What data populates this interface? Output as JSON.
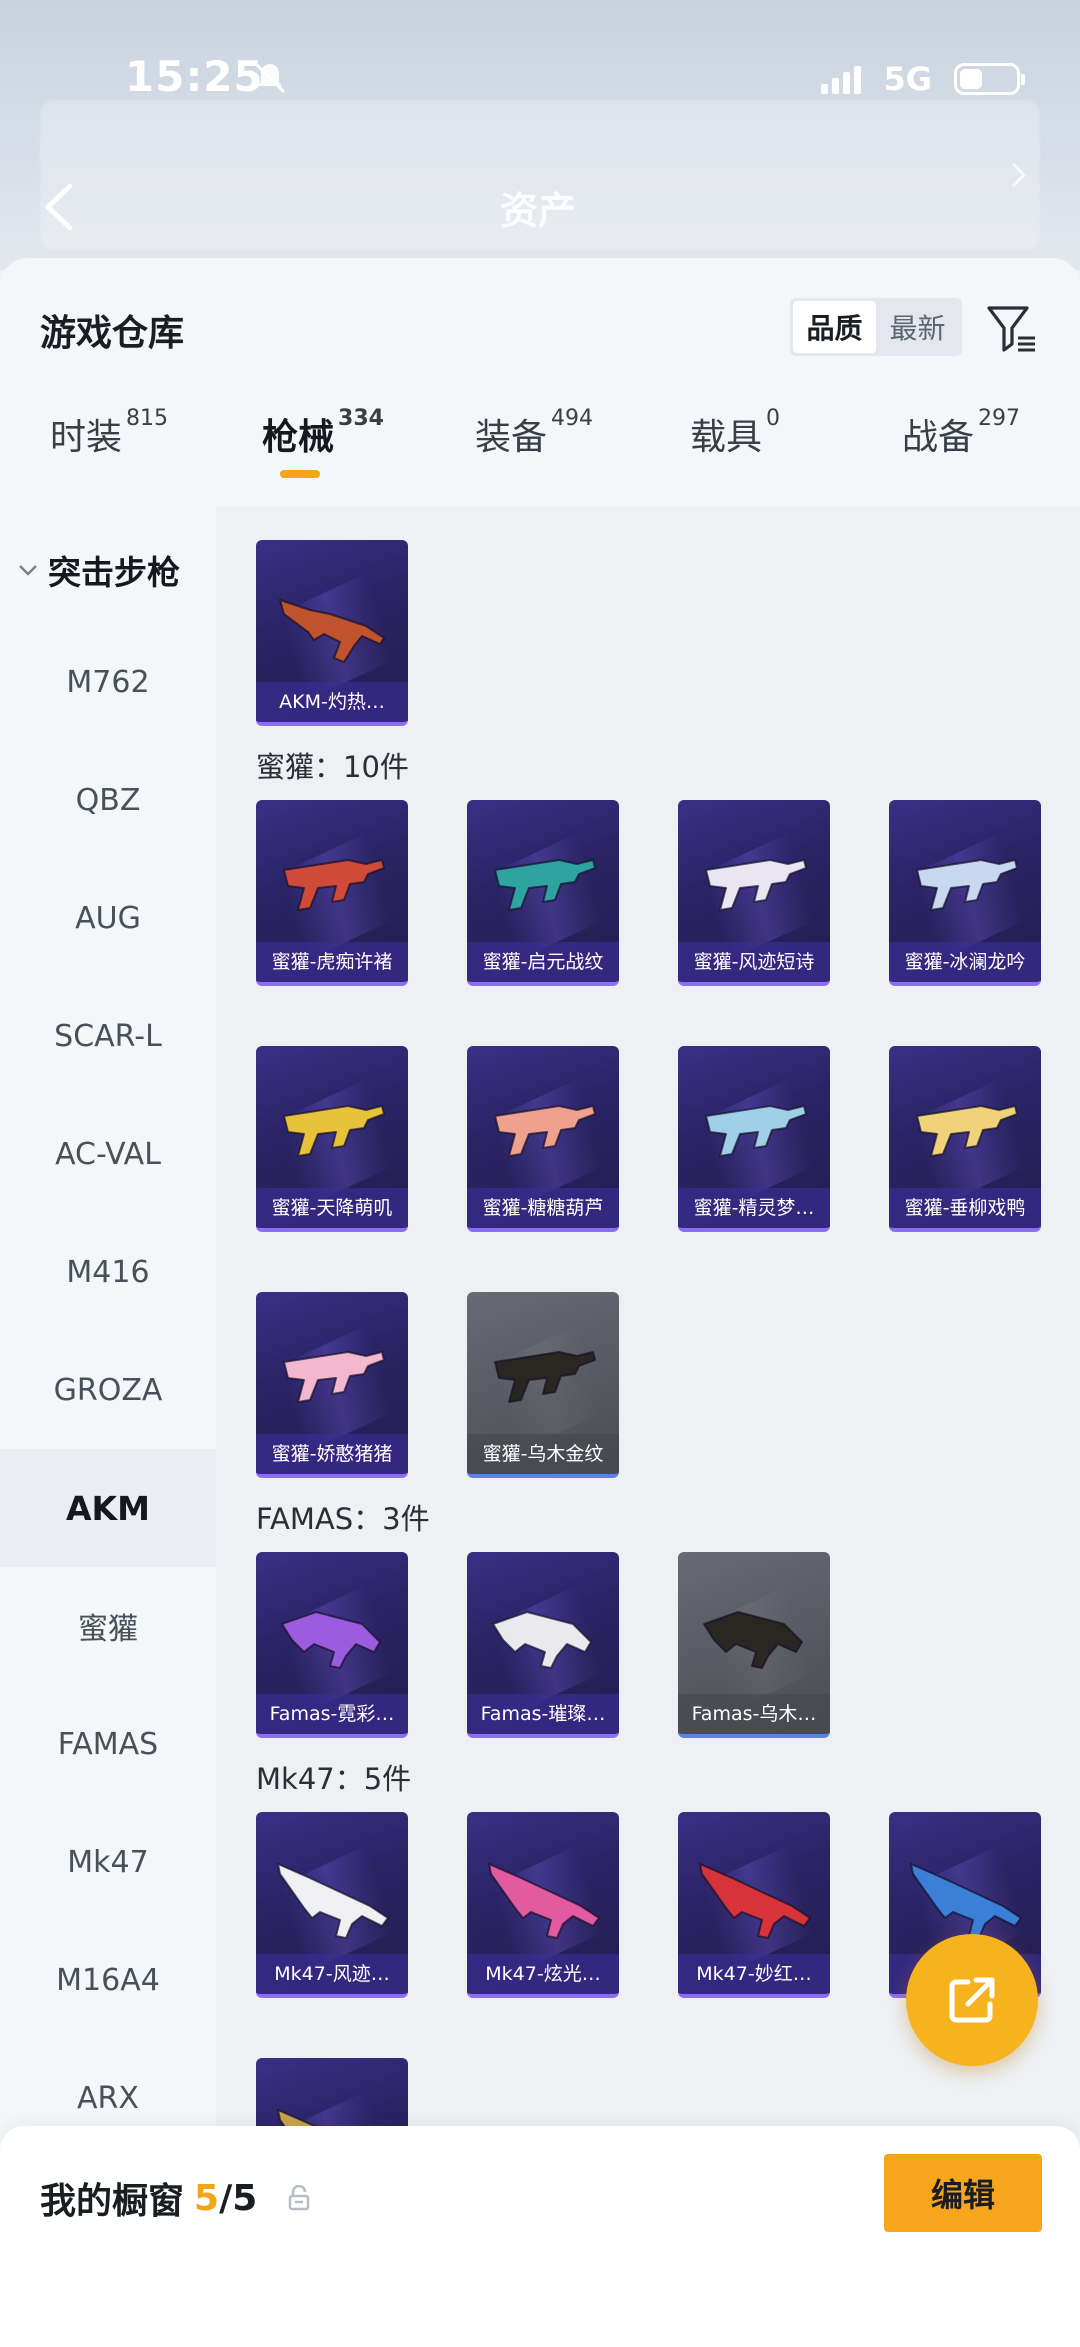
{
  "status_bar": {
    "time": "15:25",
    "network": "5G"
  },
  "header_bg": {
    "asset_title": "资产"
  },
  "sheet": {
    "title": "游戏仓库",
    "sort_options": [
      "品质",
      "最新"
    ],
    "active_sort": "品质"
  },
  "categories": [
    {
      "label": "时装",
      "count": "815"
    },
    {
      "label": "枪械",
      "count": "334"
    },
    {
      "label": "装备",
      "count": "494"
    },
    {
      "label": "载具",
      "count": "0"
    },
    {
      "label": "战备",
      "count": "297"
    }
  ],
  "sidebar": {
    "group": "突击步枪",
    "items": [
      "M762",
      "QBZ",
      "AUG",
      "SCAR-L",
      "AC-VAL",
      "M416",
      "GROZA",
      "AKM",
      "蜜獾",
      "FAMAS",
      "Mk47",
      "M16A4",
      "ARX"
    ],
    "active": "AKM"
  },
  "content": {
    "akm_cards": [
      {
        "name": "AKM-灼热…"
      }
    ],
    "sections": [
      {
        "label": "蜜獾：10件",
        "cards": [
          {
            "name": "蜜獾-虎痴许褚",
            "color": "#d04a3a"
          },
          {
            "name": "蜜獾-启元战纹",
            "color": "#2fa3a0"
          },
          {
            "name": "蜜獾-风迹短诗",
            "color": "#e9e6f2"
          },
          {
            "name": "蜜獾-冰澜龙吟",
            "color": "#c8d8f0"
          },
          {
            "name": "蜜獾-天降萌叽",
            "color": "#e8c23a"
          },
          {
            "name": "蜜獾-糖糖葫芦",
            "color": "#f0a08e"
          },
          {
            "name": "蜜獾-精灵梦…",
            "color": "#9fd0e8"
          },
          {
            "name": "蜜獾-垂柳戏鸭",
            "color": "#efd27a"
          },
          {
            "name": "蜜獾-娇憨猪猪",
            "color": "#f3b8cf"
          },
          {
            "name": "蜜獾-乌木金纹",
            "color": "#2a2622"
          }
        ]
      },
      {
        "label": "FAMAS：3件",
        "cards": [
          {
            "name": "Famas-霓彩…",
            "color": "#9b5ce0"
          },
          {
            "name": "Famas-璀璨…",
            "color": "#e9e9ee"
          },
          {
            "name": "Famas-乌木…",
            "color": "#2a2622"
          }
        ]
      },
      {
        "label": "Mk47：5件",
        "cards": [
          {
            "name": "Mk47-风迹…",
            "color": "#f0f0f4"
          },
          {
            "name": "Mk47-炫光…",
            "color": "#e25ba0"
          },
          {
            "name": "Mk47-妙红…",
            "color": "#d8333a"
          },
          {
            "name": "M…",
            "color": "#3a7fd8"
          },
          {
            "name": "",
            "color": "#c9a24a"
          }
        ]
      }
    ]
  },
  "bottom_bar": {
    "label": "我的橱窗",
    "count": "5",
    "separator": "/",
    "total": "5",
    "edit_label": "编辑"
  },
  "colors": {
    "accent": "#f6a51c",
    "card_purple": "#2a2466",
    "card_gray": "#55585f"
  }
}
